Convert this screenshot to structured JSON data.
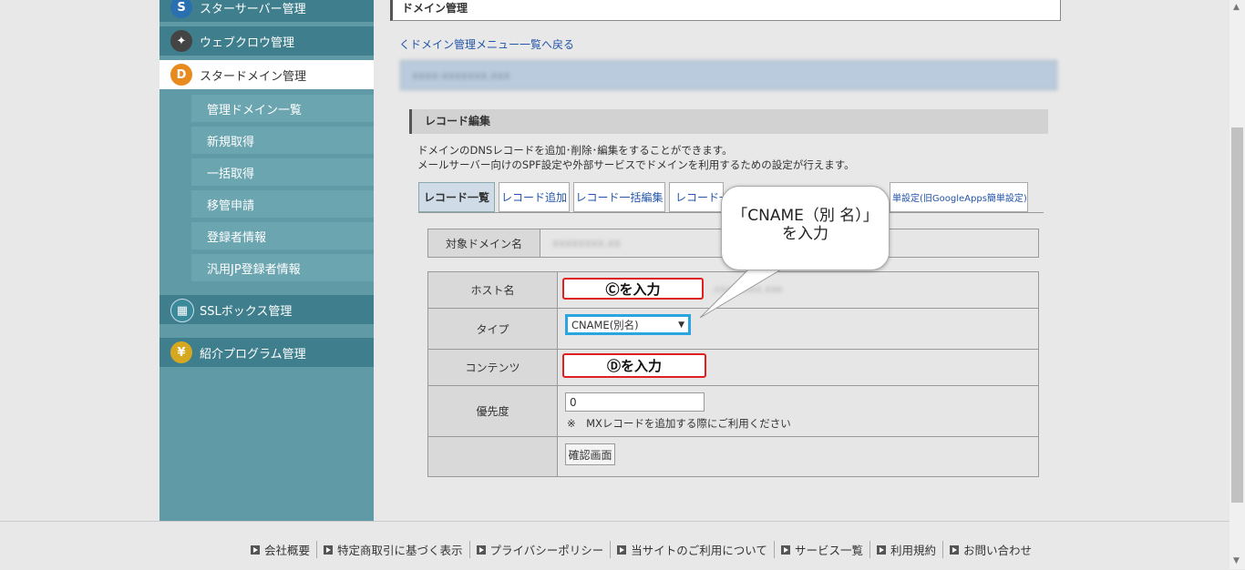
{
  "sidebar": {
    "heads": [
      {
        "label": "スターサーバー管理",
        "icon": "star-server-icon",
        "active": false
      },
      {
        "label": "ウェブクロウ管理",
        "icon": "webcrow-icon",
        "active": false
      },
      {
        "label": "スタードメイン管理",
        "icon": "star-domain-icon",
        "active": true
      },
      {
        "label": "SSLボックス管理",
        "icon": "ssl-box-icon",
        "active": false
      },
      {
        "label": "紹介プログラム管理",
        "icon": "yen-coin-icon",
        "active": false
      }
    ],
    "sub_items": [
      "管理ドメイン一覧",
      "新規取得",
      "一括取得",
      "移管申請",
      "登録者情報",
      "汎用JP登録者情報"
    ]
  },
  "main": {
    "title": "ドメイン管理",
    "back_link": "くドメイン管理メニュー一覧へ戻る",
    "section_title": "レコード編集",
    "desc_line1": "ドメインのDNSレコードを追加･削除･編集をすることができます。",
    "desc_line2": "メールサーバー向けのSPF設定や外部サービスでドメインを利用するための設定が行えます。",
    "tabs": [
      "レコード一覧",
      "レコード追加",
      "レコード一括編集",
      "レコード一",
      "単設定(旧GoogleApps簡単設定)"
    ]
  },
  "target": {
    "label": "対象ドメイン名"
  },
  "form": {
    "host_label": "ホスト名",
    "host_marker": "Ⓒを入力",
    "type_label": "タイプ",
    "type_value": "CNAME(別名)",
    "contents_label": "コンテンツ",
    "contents_marker": "Ⓓを入力",
    "priority_label": "優先度",
    "priority_value": "0",
    "priority_note": "※　MXレコードを追加する際にご利用ください",
    "confirm_button": "確認画面"
  },
  "callout": {
    "line1": "「CNAME（別 名）」",
    "line2": "を入力"
  },
  "footer": {
    "links": [
      "会社概要",
      "特定商取引に基づく表示",
      "プライバシーポリシー",
      "当サイトのご利用について",
      "サービス一覧",
      "利用規約",
      "お問い合わせ"
    ]
  },
  "colors": {
    "sidebar": "#5f9aa6",
    "sidebar_head": "#3f7f8d",
    "highlight_red": "#e02020",
    "highlight_blue": "#2aa5e0"
  }
}
